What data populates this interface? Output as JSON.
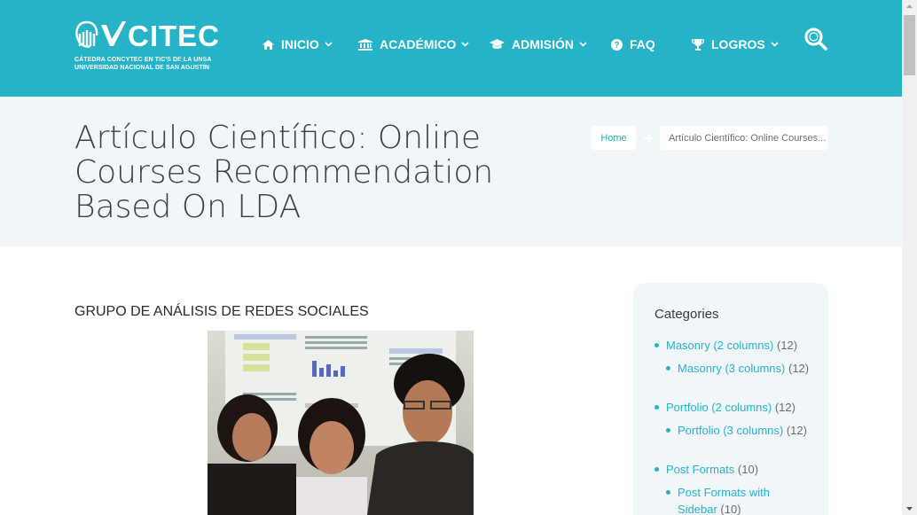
{
  "brand": {
    "name": "CITEC",
    "subtitle_line1": "CÁTEDRA CONCYTEC EN TIC'S DE LA UNSA",
    "subtitle_line2": "UNIVERSIDAD NACIONAL DE SAN AGUSTÍN",
    "accent_color": "#26b3c7"
  },
  "nav": {
    "items": [
      {
        "label": "INICIO",
        "icon": "home-icon",
        "has_dropdown": true
      },
      {
        "label": "ACADÉMICO",
        "icon": "university-icon",
        "has_dropdown": true
      },
      {
        "label": "ADMISIÓN",
        "icon": "graduation-cap-icon",
        "has_dropdown": true
      },
      {
        "label": "FAQ",
        "icon": "question-circle-icon",
        "has_dropdown": false
      },
      {
        "label": "LOGROS",
        "icon": "trophy-icon",
        "has_dropdown": true
      }
    ],
    "search_icon": "search-icon"
  },
  "page": {
    "title": "Artículo Científico: Online Courses Recommendation Based On LDA"
  },
  "breadcrumb": {
    "home": "Home",
    "current": "Artículo Científico: Online Courses..."
  },
  "content": {
    "heading": "GRUPO DE ANÁLISIS DE REDES SOCIALES"
  },
  "sidebar": {
    "title": "Categories",
    "categories": [
      {
        "name": "Masonry (2 columns)",
        "count": "(12)"
      },
      {
        "name": "Masonry (3 columns)",
        "count": "(12)"
      },
      {
        "name": "Portfolio (2 columns)",
        "count": "(12)"
      },
      {
        "name": "Portfolio (3 columns)",
        "count": "(12)"
      },
      {
        "name": "Post Formats",
        "count": "(10)"
      },
      {
        "name": "Post Formats with Sidebar",
        "count": "(10)"
      }
    ]
  }
}
